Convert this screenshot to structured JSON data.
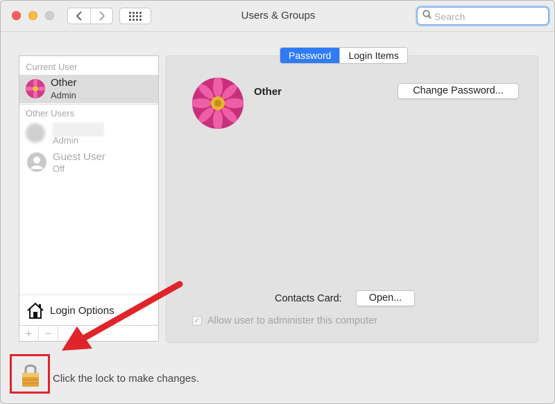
{
  "window": {
    "title": "Users & Groups"
  },
  "toolbar": {
    "back_icon": "chevron-left-icon",
    "forward_icon": "chevron-right-icon",
    "show_all_icon": "grid-icon",
    "search_placeholder": "Search"
  },
  "sidebar": {
    "current_user_header": "Current User",
    "current_user": {
      "name": "Other",
      "role": "Admin"
    },
    "other_users_header": "Other Users",
    "other_users": [
      {
        "name": "",
        "role": "Admin"
      },
      {
        "name": "Guest User",
        "role": "Off"
      }
    ],
    "login_options_label": "Login Options",
    "add_label": "+",
    "remove_label": "−"
  },
  "tabs": [
    {
      "label": "Password",
      "active": true
    },
    {
      "label": "Login Items",
      "active": false
    }
  ],
  "main": {
    "user_name": "Other",
    "change_password_label": "Change Password...",
    "contacts_card_label": "Contacts Card:",
    "open_label": "Open...",
    "allow_admin_label": "Allow user to administer this computer",
    "allow_admin_checked": true
  },
  "footer": {
    "lock_label": "Click the lock to make changes."
  },
  "colors": {
    "accent": "#2f7bf6",
    "annotation": "#e0242b"
  }
}
